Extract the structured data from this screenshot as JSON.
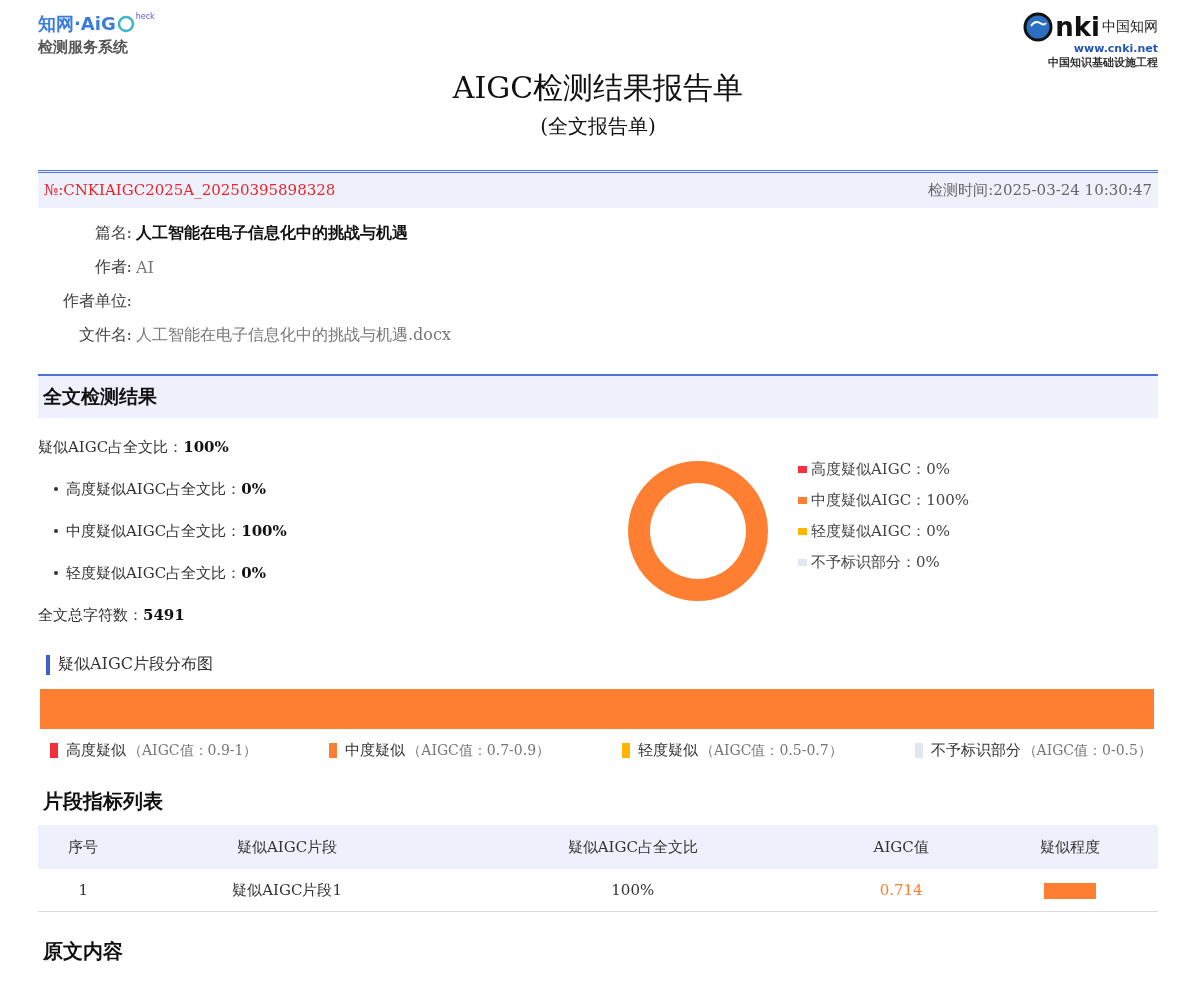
{
  "header": {
    "logo_left": {
      "brand": "知网·AiG",
      "badge": "heck",
      "subtitle": "检测服务系统"
    },
    "logo_right": {
      "mark": "nki",
      "name": "中国知网",
      "url": "www.cnki.net",
      "tagline": "中国知识基础设施工程"
    },
    "title": "AIGC检测结果报告单",
    "subtitle": "(全文报告单)"
  },
  "report": {
    "number": "№:CNKIAIGC2025A_20250395898328",
    "time": "检测时间:2025-03-24 10:30:47"
  },
  "fields": [
    {
      "label": "篇名:",
      "value": "人工智能在电子信息化中的挑战与机遇",
      "emphasis": true
    },
    {
      "label": "作者:",
      "value": "AI",
      "emphasis": false
    },
    {
      "label": "作者单位:"
    },
    {
      "label": "文件名:",
      "value": "人工智能在电子信息化中的挑战与机遇.docx",
      "emphasis": false
    }
  ],
  "result": {
    "heading": "全文检测结果",
    "total": {
      "label": "疑似AIGC占全文比：",
      "value": "100%"
    },
    "breakdown": [
      {
        "label": "高度疑似AIGC占全文比：",
        "value": "0%"
      },
      {
        "label": "中度疑似AIGC占全文比：",
        "value": "100%"
      },
      {
        "label": "轻度疑似AIGC占全文比：",
        "value": "0%"
      }
    ],
    "chars": {
      "label": "全文总字符数：",
      "value": "5491"
    },
    "chart_data": {
      "type": "donut",
      "categories": [
        "高度疑似AIGC",
        "中度疑似AIGC",
        "轻度疑似AIGC",
        "不予标识部分"
      ],
      "values": [
        0,
        100,
        0,
        0
      ]
    },
    "legend": [
      {
        "value": "：0%",
        "color": "#f5303c"
      },
      {
        "value": "：100%",
        "color": "#ff7f32"
      },
      {
        "value": "：0%",
        "color": "#ffb400"
      },
      {
        "value": "：0%",
        "color": "#e2e6ee"
      }
    ]
  },
  "distribution": {
    "heading": "疑似AIGC片段分布图",
    "segments": [
      {
        "level": 1,
        "color": "#ff7f32"
      }
    ],
    "legend": [
      {
        "label": "高度疑似",
        "range": "（AIGC值：0.9-1）",
        "color": "#f5303c"
      },
      {
        "label": "中度疑似",
        "range": "（AIGC值：0.7-0.9）",
        "color": "#ff7f32"
      },
      {
        "label": "轻度疑似",
        "range": "（AIGC值：0.5-0.7）",
        "color": "#ffb400"
      },
      {
        "label": "不予标识部分",
        "range": "（AIGC值：0-0.5）",
        "color": "#e2e6ee"
      }
    ]
  },
  "table": {
    "heading": "片段指标列表",
    "columns": [
      "序号",
      "疑似AIGC片段",
      "疑似AIGC占全文比",
      "AIGC值",
      "疑似程度"
    ],
    "rows": [
      {
        "index": "1",
        "segment": "疑似AIGC片段1",
        "share": "100%",
        "value": "0.714",
        "color": "#ff7f32"
      }
    ]
  },
  "original": {
    "heading": "原文内容"
  }
}
